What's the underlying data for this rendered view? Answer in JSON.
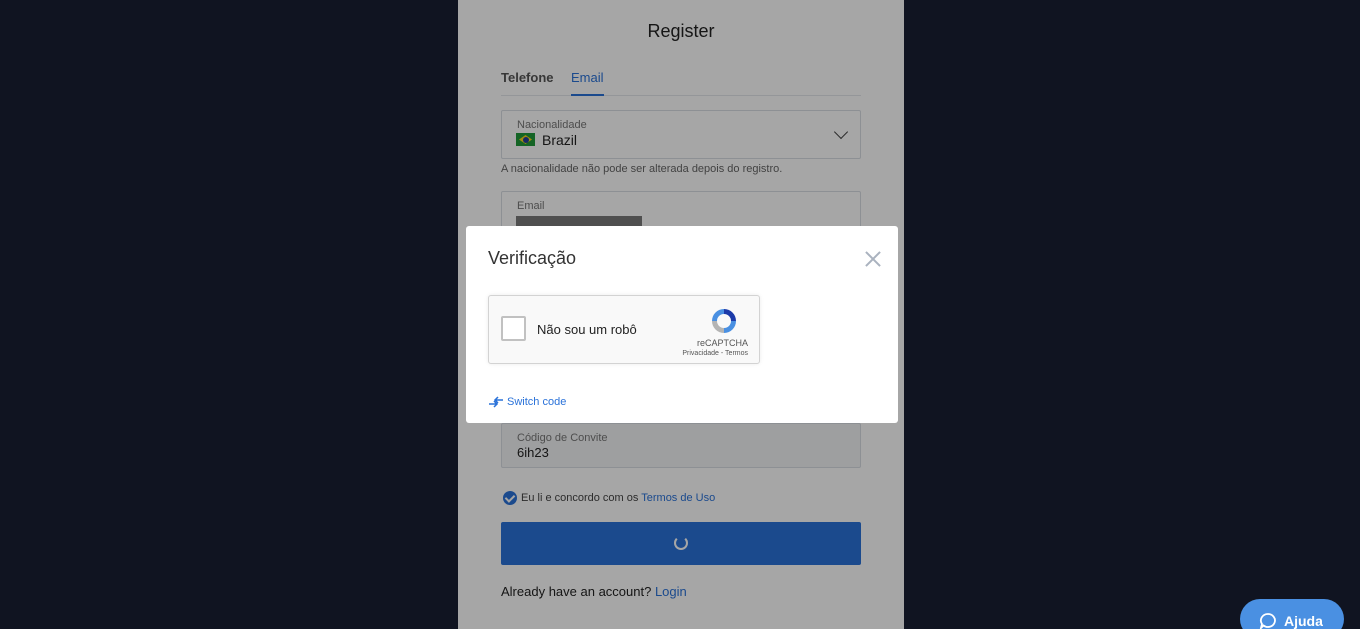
{
  "register": {
    "title": "Register",
    "tabs": [
      {
        "label": "Telefone"
      },
      {
        "label": "Email"
      }
    ],
    "nationality": {
      "label": "Nacionalidade",
      "value": "Brazil",
      "note": "A nacionalidade não pode ser alterada depois do registro."
    },
    "email": {
      "label": "Email"
    },
    "invite": {
      "label": "Código de Convite",
      "value": "6ih23"
    },
    "terms": {
      "text": "Eu li e concordo com os ",
      "link": "Termos de Uso"
    },
    "login": {
      "text": "Already have an account? ",
      "link": "Login"
    }
  },
  "modal": {
    "title": "Verificação",
    "captcha": {
      "label": "Não sou um robô",
      "brand": "reCAPTCHA",
      "links": "Privacidade - Termos"
    },
    "switch_label": "Switch code"
  },
  "help": {
    "label": "Ajuda"
  },
  "colors": {
    "accent": "#2a72d9",
    "background": "#191f33"
  }
}
